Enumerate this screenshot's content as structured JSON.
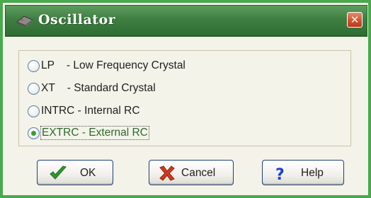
{
  "window": {
    "title": "Oscillator",
    "close_glyph": "✕"
  },
  "options": [
    {
      "code": "LP",
      "label": "LP    - Low Frequency Crystal",
      "checked": false
    },
    {
      "code": "XT",
      "label": "XT    - Standard Crystal",
      "checked": false
    },
    {
      "code": "INTRC",
      "label": "INTRC - Internal RC",
      "checked": false
    },
    {
      "code": "EXTRC",
      "label": "EXTRC - External RC",
      "checked": true
    }
  ],
  "buttons": {
    "ok": {
      "label": "OK",
      "icon": "checkmark-icon"
    },
    "cancel": {
      "label": "Cancel",
      "icon": "x-mark-icon"
    },
    "help": {
      "label": "Help",
      "icon": "question-mark-icon"
    }
  },
  "colors": {
    "frame": "#4aa84e",
    "titlebar": "#3f7f41",
    "close": "#d3522f",
    "accent_check": "#3b9b3b",
    "help_blue": "#1d3fd0"
  }
}
